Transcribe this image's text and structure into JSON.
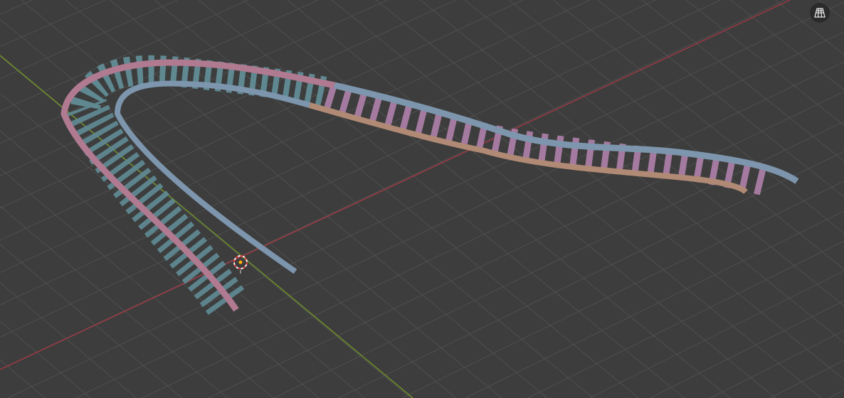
{
  "viewport": {
    "background": "#3d3d3d",
    "grid_color": "#4f4f4f",
    "x_axis_color": "#9c3a45",
    "y_axis_color": "#6f8f2a"
  },
  "gizmo": {
    "icon": "perspective-grid-icon"
  },
  "track": {
    "rail_pink": "#b07a90",
    "rail_blue": "#7d96ad",
    "rail_orange": "#b08a74",
    "tie_teal": "#6f9aa3",
    "tie_pink": "#a57aa0"
  }
}
